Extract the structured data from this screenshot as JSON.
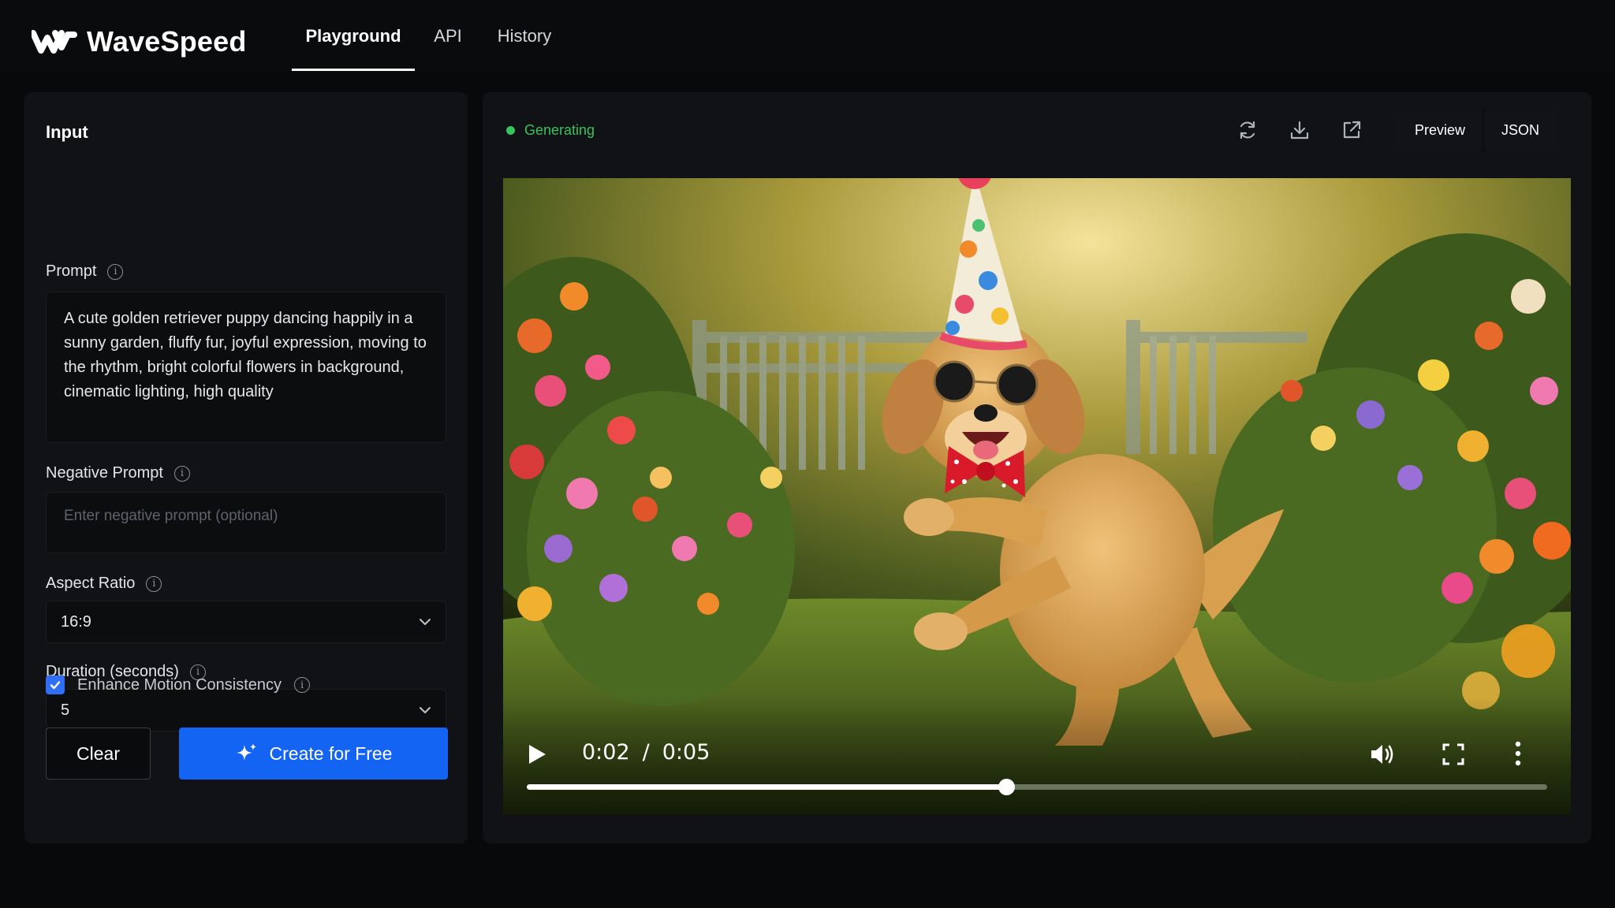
{
  "brand": {
    "name": "WaveSpeed"
  },
  "nav": {
    "tabs": [
      {
        "label": "Playground"
      },
      {
        "label": "API"
      },
      {
        "label": "History"
      }
    ]
  },
  "input_panel": {
    "title": "Input",
    "prompt": {
      "label": "Prompt",
      "value": "A cute golden retriever puppy dancing happily in a sunny garden, fluffy fur, joyful expression, moving to the rhythm, bright colorful flowers in background, cinematic lighting, high quality"
    },
    "negative_prompt": {
      "label": "Negative Prompt",
      "value": "",
      "placeholder": "Enter negative prompt (optional)"
    },
    "aspect_ratio": {
      "label": "Aspect Ratio",
      "value": "16:9"
    },
    "duration": {
      "label": "Duration (seconds)",
      "value": "5"
    },
    "enhance_motion": {
      "label": "Enhance Motion Consistency",
      "checked": true
    },
    "clear_label": "Clear",
    "create_label": "Create for Free"
  },
  "output_panel": {
    "status": "Generating",
    "status_color": "#36c25c",
    "icons": [
      "refresh-icon",
      "download-icon",
      "external-link-icon"
    ],
    "view_toggle": {
      "preview": "Preview",
      "json": "JSON"
    },
    "video": {
      "current_time": "0:02",
      "separator": "/",
      "duration": "0:05",
      "progress": 0.47
    }
  },
  "colors": {
    "accent": "#1464f4",
    "checkbox": "#2f6ef5",
    "background": "#08090b",
    "panel": "#111215"
  }
}
